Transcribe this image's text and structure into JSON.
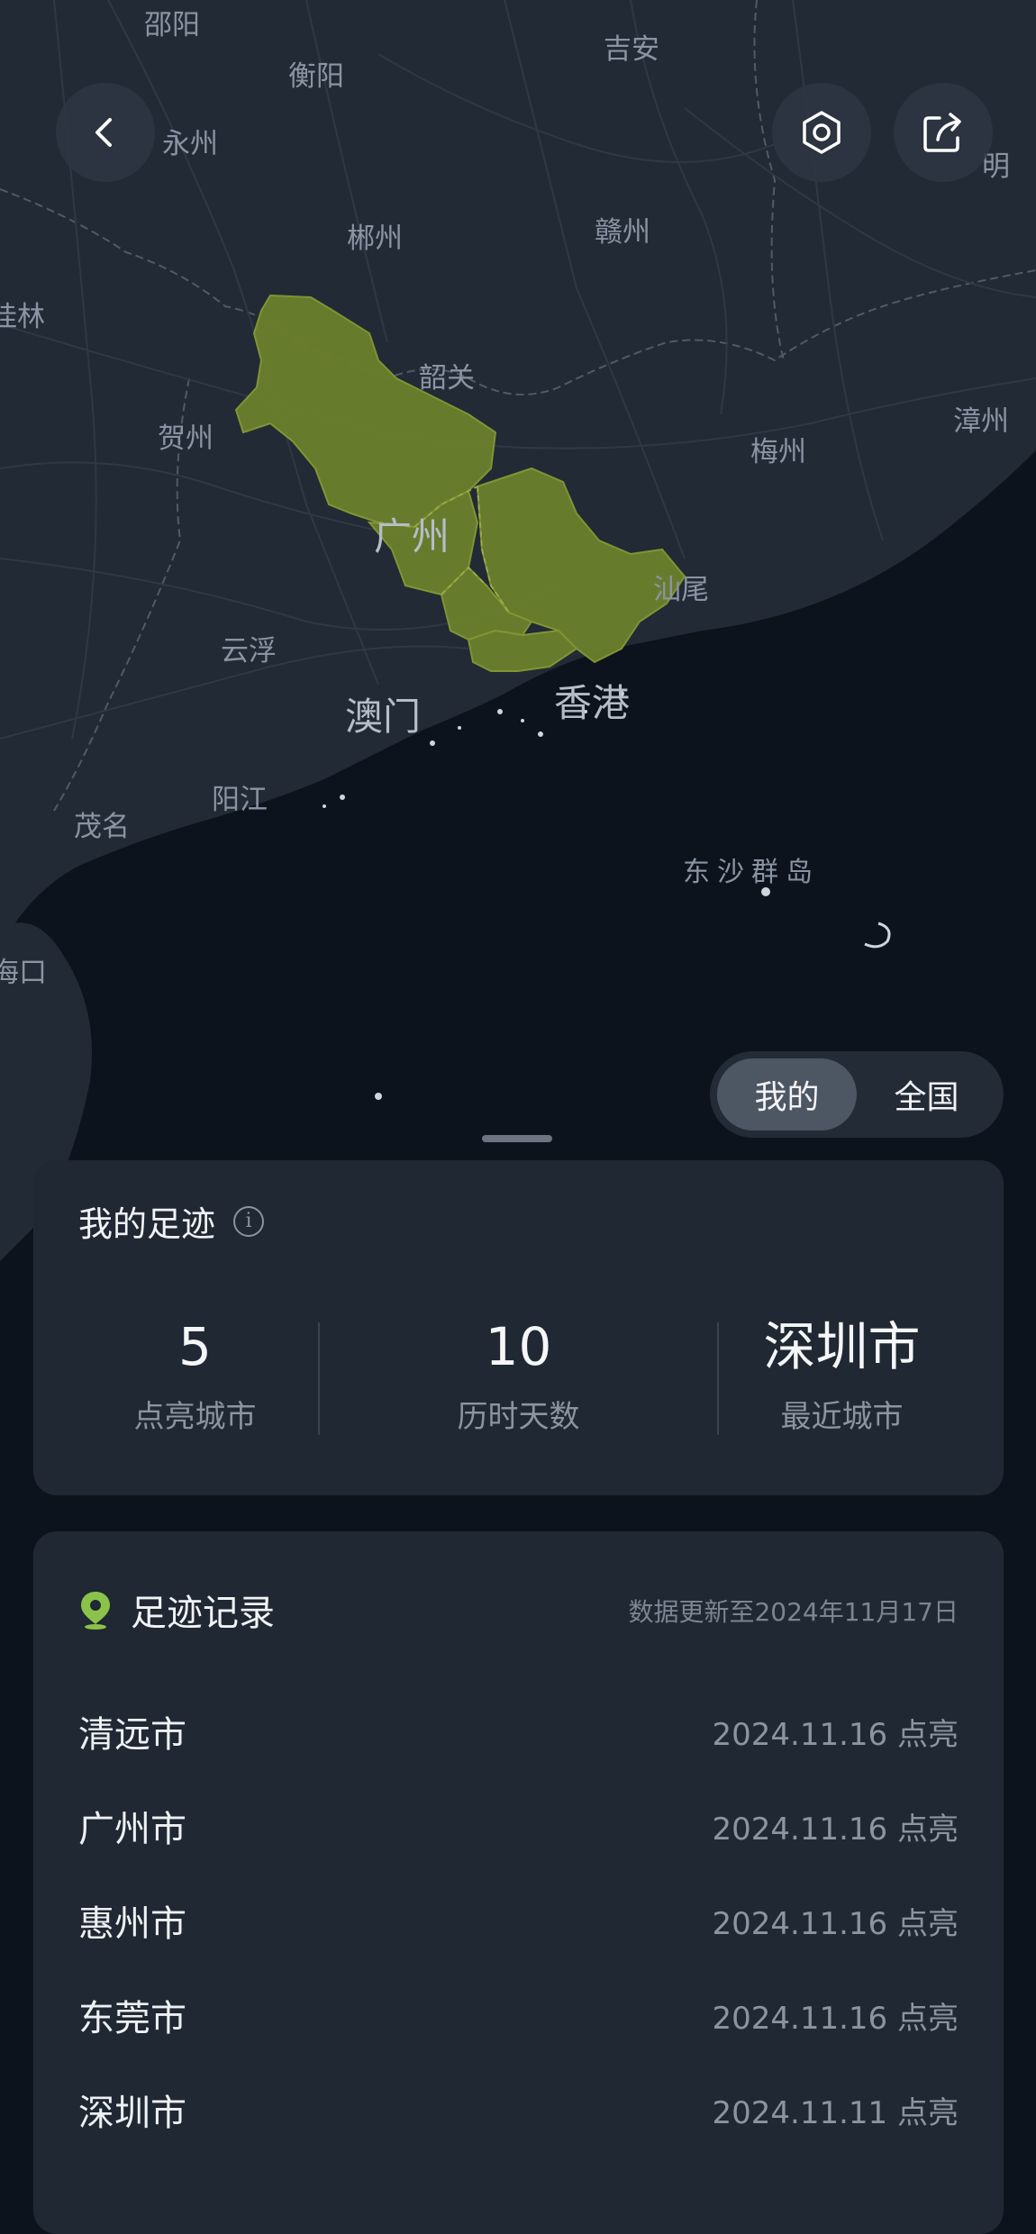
{
  "map": {
    "labels": [
      "邵阳",
      "吉安",
      "衡阳",
      "永州",
      "明",
      "郴州",
      "赣州",
      "桂林",
      "韶关",
      "漳州",
      "贺州",
      "梅州",
      "广州",
      "汕尾",
      "云浮",
      "澳门",
      "香港",
      "阳江",
      "茂名",
      "东沙群岛",
      "海口"
    ],
    "highlight_color": "#6b7f2c"
  },
  "header": {
    "back_icon": "chevron-left-icon",
    "settings_icon": "settings-icon",
    "share_icon": "share-icon"
  },
  "toggle": {
    "mine": "我的",
    "nation": "全国"
  },
  "stats": {
    "title": "我的足迹",
    "info_icon": "i",
    "items": [
      {
        "value": "5",
        "label": "点亮城市"
      },
      {
        "value": "10",
        "label": "历时天数"
      },
      {
        "value": "深圳市",
        "label": "最近城市"
      }
    ]
  },
  "records": {
    "title": "足迹记录",
    "updated": "数据更新至2024年11月17日",
    "items": [
      {
        "city": "清远市",
        "date": "2024.11.16 点亮"
      },
      {
        "city": "广州市",
        "date": "2024.11.16 点亮"
      },
      {
        "city": "惠州市",
        "date": "2024.11.16 点亮"
      },
      {
        "city": "东莞市",
        "date": "2024.11.16 点亮"
      },
      {
        "city": "深圳市",
        "date": "2024.11.11 点亮"
      }
    ]
  },
  "colors": {
    "background": "#0d131c",
    "card": "#1f2833",
    "accent_green": "#8bc34a"
  }
}
